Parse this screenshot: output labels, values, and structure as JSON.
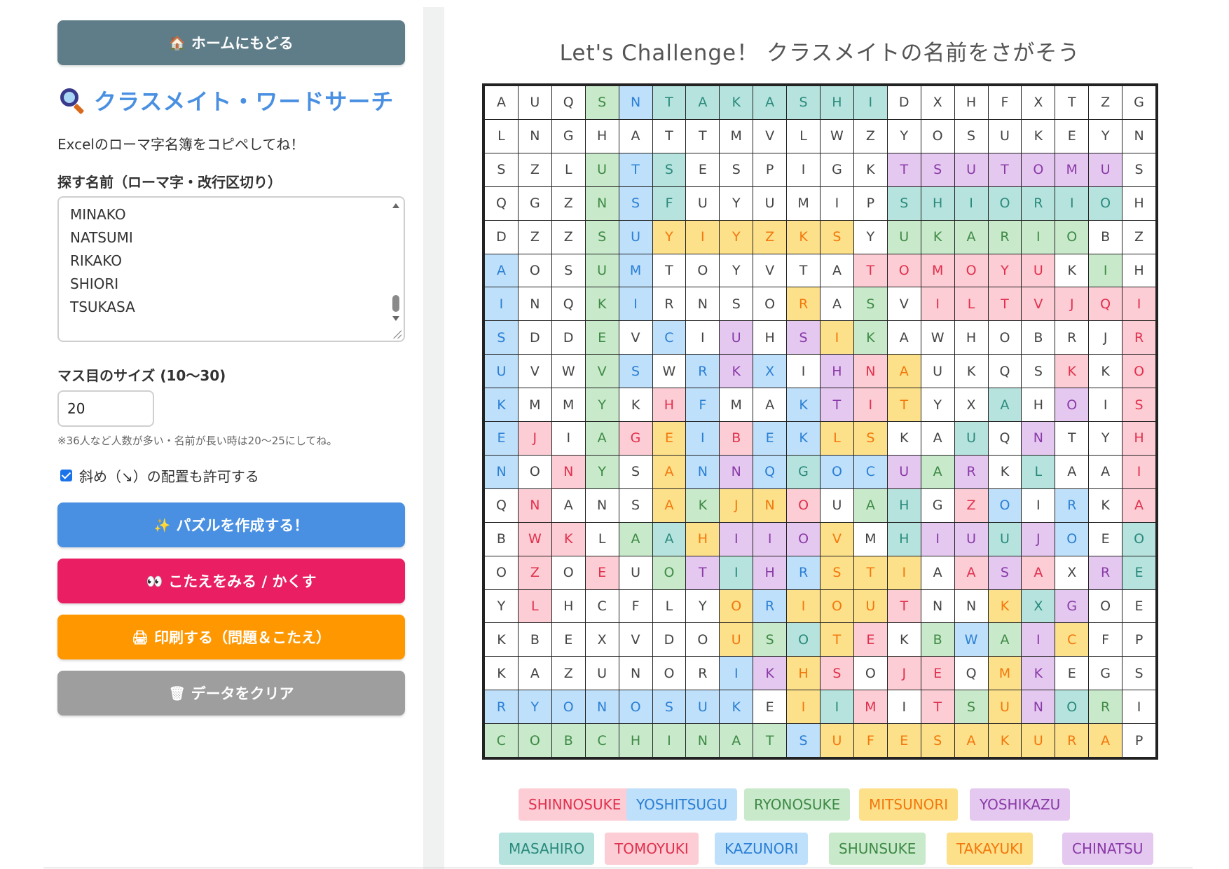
{
  "sidebar": {
    "home_button": {
      "icon": "house-icon",
      "label": "ホームにもどる"
    },
    "app_title": "クラスメイト・ワードサーチ",
    "subtitle": "Excelのローマ字名簿をコピペしてね！",
    "names_label": "探す名前（ローマ字・改行区切り）",
    "names_visible": [
      "MINAKO",
      "NATSUMI",
      "RIKAKO",
      "SHIORI",
      "TSUKASA"
    ],
    "size_label": "マス目のサイズ (10〜30)",
    "size_value": "20",
    "size_note": "※36人など人数が多い・名前が長い時は20〜25にしてね。",
    "diagonal_label": "斜め（↘）の配置も許可する",
    "diagonal_checked": true,
    "make_button": {
      "icon": "sparkles-icon",
      "label": "パズルを作成する！"
    },
    "answer_button": {
      "icon": "eyes-icon",
      "label": "こたえをみる / かくす"
    },
    "print_button": {
      "icon": "printer-icon",
      "label": "印刷する（問題＆こたえ）"
    },
    "clear_button": {
      "icon": "trash-icon",
      "label": "データをクリア"
    }
  },
  "puzzle": {
    "title": "Let's Challenge！ クラスメイトの名前をさがそう",
    "size": 20,
    "colors": {
      "p": {
        "bg": "#fccdd4",
        "fg": "#e0304e"
      },
      "b": {
        "bg": "#bfe0fb",
        "fg": "#2a7fd4"
      },
      "g": {
        "bg": "#c9e9cb",
        "fg": "#3e8a45"
      },
      "y": {
        "bg": "#fde08a",
        "fg": "#f2780c"
      },
      "v": {
        "bg": "#e4c8ef",
        "fg": "#8a3aa8"
      },
      "t": {
        "bg": "#b6e3dd",
        "fg": "#2a8a7c"
      }
    },
    "letters": [
      "AUQSNTAKASHIDXHFXTZG",
      "LNGHATTMVLWZYOSUKEYN",
      "SZLUTSESPIGKTSUTOMUS",
      "QGZNSFUYUMIPSHIORIOH",
      "DZZSUYIYZKSYUKARIOBZ",
      "AOSUMTOYVTATOMOYUKIH",
      "INQKIRNSORASVILTVJQI",
      "SDDEVCIUHSIKAWHOBRJR",
      "UVWVSWRKXIHNAUKQSKKO",
      "KMMYKHFMAKTITYXAHOIS",
      "EJIAGEIBEKLSKAUQNTYH",
      "NONYSANNQGOCUARKLAAI",
      "QNANSAKJNOUAHGZOIRKA",
      "BWKLAAHIIOVMHIUUJOEO",
      "OZOEUOTIHRSTIAASAXRE",
      "YLHCFLYORIOUTNNKXGOE",
      "KBEXVDOUSOTEKBWAICFP",
      "KAZUNORIKHSOJEQMKEGS",
      "RYONOSUKEIIMITSUNORI",
      "COBCHINATSUFESAKURAP"
    ],
    "highlights": [
      "...gbttttttt.......",
      ".....................",
      "...gbt......vvvvvvv..",
      "...gbt......ttttttt..",
      "...gbyyyyyy.gggggg...",
      "b..gb......pppppp.g..",
      "b..gb....y.g.ppppppp",
      "b..g.b.v.vyg.......p",
      "b..gb.bvb.vpy....p.p",
      "b..g.pb..bvpy..t.v.p",
      "bp.gpybpbbyy..t.v..p",
      "b.pg.ybvbtbbvgv.ti.p",
      ".p...ygyyp.gt.pb.b.p",
      ".pp.gtyvvvy.tvvtvb.t",
      ".p.p.gvtvbyyy.pvp.vt",
      ".p.....ybyyyp..ytv..",
      ".......ygtyp.gbgvy..",
      ".......bvyp.pp.yv...",
      "bbbbbbbb.ytp.pgyvtg.",
      "gggggggggbyyyyyyyyy",
      "...vvvvvvvv..tttttt."
    ],
    "found_words": [
      {
        "label": "SHINNOSUKE",
        "color": "p"
      },
      {
        "label": "YOSHITSUGU",
        "color": "b"
      },
      {
        "label": "RYONOSUKE",
        "color": "g"
      },
      {
        "label": "MITSUNORI",
        "color": "y"
      },
      {
        "label": "YOSHIKAZU",
        "color": "v"
      },
      {
        "label": "MASAHIRO",
        "color": "t"
      },
      {
        "label": "TOMOYUKI",
        "color": "p"
      },
      {
        "label": "KAZUNORI",
        "color": "b"
      },
      {
        "label": "SHUNSUKE",
        "color": "g"
      },
      {
        "label": "TAKAYUKI",
        "color": "y"
      },
      {
        "label": "CHINATSU",
        "color": "v"
      }
    ]
  }
}
